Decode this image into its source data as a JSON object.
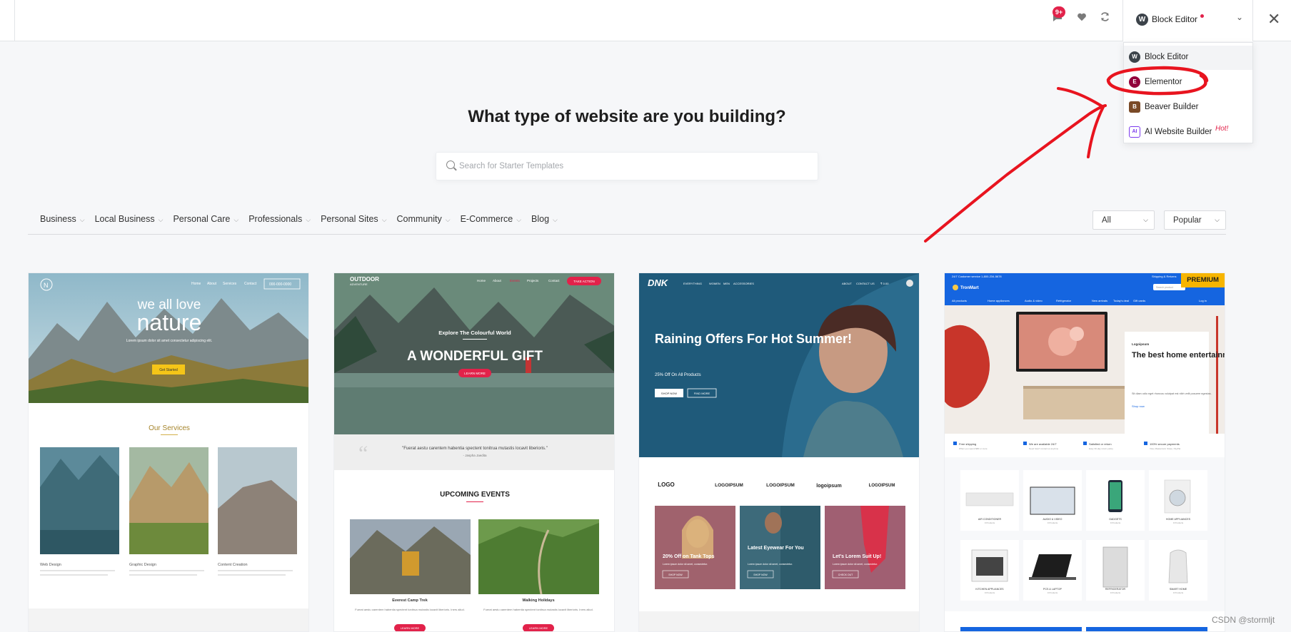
{
  "topbar": {
    "notification_badge": "9+",
    "builder_selected": "Block Editor"
  },
  "builder_menu": {
    "items": [
      {
        "label": "Block Editor",
        "icon": "wordpress-icon"
      },
      {
        "label": "Elementor",
        "icon": "elementor-icon"
      },
      {
        "label": "Beaver Builder",
        "icon": "beaver-icon"
      },
      {
        "label": "AI Website Builder",
        "icon": "ai-icon",
        "badge": "Hot!"
      }
    ]
  },
  "main": {
    "headline": "What type of website are you building?",
    "search_placeholder": "Search for Starter Templates"
  },
  "categories": [
    "Business",
    "Local Business",
    "Personal Care",
    "Professionals",
    "Personal Sites",
    "Community",
    "E-Commerce",
    "Blog"
  ],
  "filters": {
    "type": "All",
    "sort": "Popular"
  },
  "templates": [
    {
      "nav": [
        "Home",
        "About",
        "Services",
        "Contact"
      ],
      "nav_button": "000-000-0000",
      "hero_small": "we all love",
      "hero_big": "nature",
      "hero_copy": "Lorem ipsum dolor sit amet consectetur adipiscing elit.",
      "hero_button": "Get Started",
      "section_title": "Our Services",
      "services": [
        {
          "title": "Web Design",
          "text": "Focus on how you can help and benefit your user. Use simple words so that you don't confuse people."
        },
        {
          "title": "Graphic Design",
          "text": "Focus on how you can help and benefit your user. Use simple words so that you don't confuse people."
        },
        {
          "title": "Content Creation",
          "text": "Focus on how you can help and benefit your user. Use simple words so that you don't confuse people."
        }
      ]
    },
    {
      "logo": "OUTDOOR",
      "logo_sub": "ADVENTURE",
      "nav": [
        "Home",
        "About",
        "Events",
        "Projects",
        "Contact"
      ],
      "nav_button": "TAKE ACTION",
      "hero_small": "Explore The Colourful World",
      "hero_big": "A WONDERFUL GIFT",
      "hero_button": "LEARN MORE",
      "quote": "\"Fuerat aestu carentem habentia spectent tonitrua mutastis locavit liberioris.\"",
      "quote_author": "- Jaspha Jaedita",
      "section_title": "UPCOMING EVENTS",
      "events": [
        {
          "title": "Everest Camp Trek",
          "text": "Fuerat aestu carentem habentia spectent tonitrua mutastis locavit liberioris. Iners aliud.",
          "button": "LEARN MORE"
        },
        {
          "title": "Walking Holidays",
          "text": "Fuerat aestu carentem habentia spectent tonitrua mutastis locavit liberioris. Iners aliud.",
          "button": "LEARN MORE"
        }
      ]
    },
    {
      "logo": "DNK",
      "nav": [
        "EVERYTHING",
        "WOMEN",
        "MEN",
        "ACCESSORIES"
      ],
      "nav_right": [
        "ABOUT",
        "CONTACT US"
      ],
      "cart": "₹ 0.00",
      "hero_title": "Raining Offers For Hot Summer!",
      "hero_sub": "25% Off On All Products",
      "hero_buttons": [
        "SHOP NOW",
        "FIND MORE"
      ],
      "logos": [
        "LOGO",
        "LOGOIPSUM",
        "LOGOIPSUM",
        "logoipsum",
        "LOGOIPSUM"
      ],
      "promos": [
        {
          "title": "20% Off on Tank Tops",
          "text": "Lorem ipsum dolor sit amet, consectetur.",
          "button": "SHOP NOW"
        },
        {
          "title": "Latest Eyewear For You",
          "text": "Lorem ipsum dolor sit amet, consectetur.",
          "button": "SHOP NOW"
        },
        {
          "title": "Let's Lorem Suit Up!",
          "text": "Lorem ipsum dolor sit amet, consectetur.",
          "button": "CHECK OUT"
        }
      ]
    },
    {
      "premium": "PREMIUM",
      "top_left": "24/7 Customer service 1-800-234-5678",
      "top_right": "Shipping & Returns",
      "logo": "TronMart",
      "search_placeholder": "Search product",
      "menu": [
        "All products",
        "Home appliances",
        "Audio & video",
        "Refrigerator",
        "New arrivals",
        "Today's deal",
        "Gift cards"
      ],
      "login": "Log in",
      "hero_brand": "Logoipsum",
      "hero_title": "The best home entertainment system is here",
      "hero_copy": "Sit diam odio eget rhoncus volutpat est nibh velit posuere egestas.",
      "hero_link": "Shop now",
      "features": [
        {
          "title": "Free shipping",
          "text": "When you spend $80 or more"
        },
        {
          "title": "We are available 24/7",
          "text": "Need help? contact us anytime"
        },
        {
          "title": "Satisfied or return",
          "text": "Easy 30-day return policy"
        },
        {
          "title": "100% secure payments",
          "text": "Visa, Mastercard, Stripe, PayPal"
        }
      ],
      "products": [
        {
          "title": "AIR CONDITIONER",
          "count": "9 Products"
        },
        {
          "title": "AUDIO & VIDEO",
          "count": "9 Products"
        },
        {
          "title": "GADGETS",
          "count": "9 Products"
        },
        {
          "title": "HOME APPLIANCES",
          "count": "9 Products"
        },
        {
          "title": "KITCHEN APPLIANCES",
          "count": "9 Products"
        },
        {
          "title": "PCS & LAPTOP",
          "count": "9 Products"
        },
        {
          "title": "REFRIGERATOR",
          "count": "9 Products"
        },
        {
          "title": "SMART HOME",
          "count": "9 Products"
        }
      ]
    }
  ],
  "watermark": "CSDN @stormljt",
  "colors": {
    "accent": "#e2224a",
    "annotation": "#e8141f",
    "premium": "#f7b500"
  }
}
